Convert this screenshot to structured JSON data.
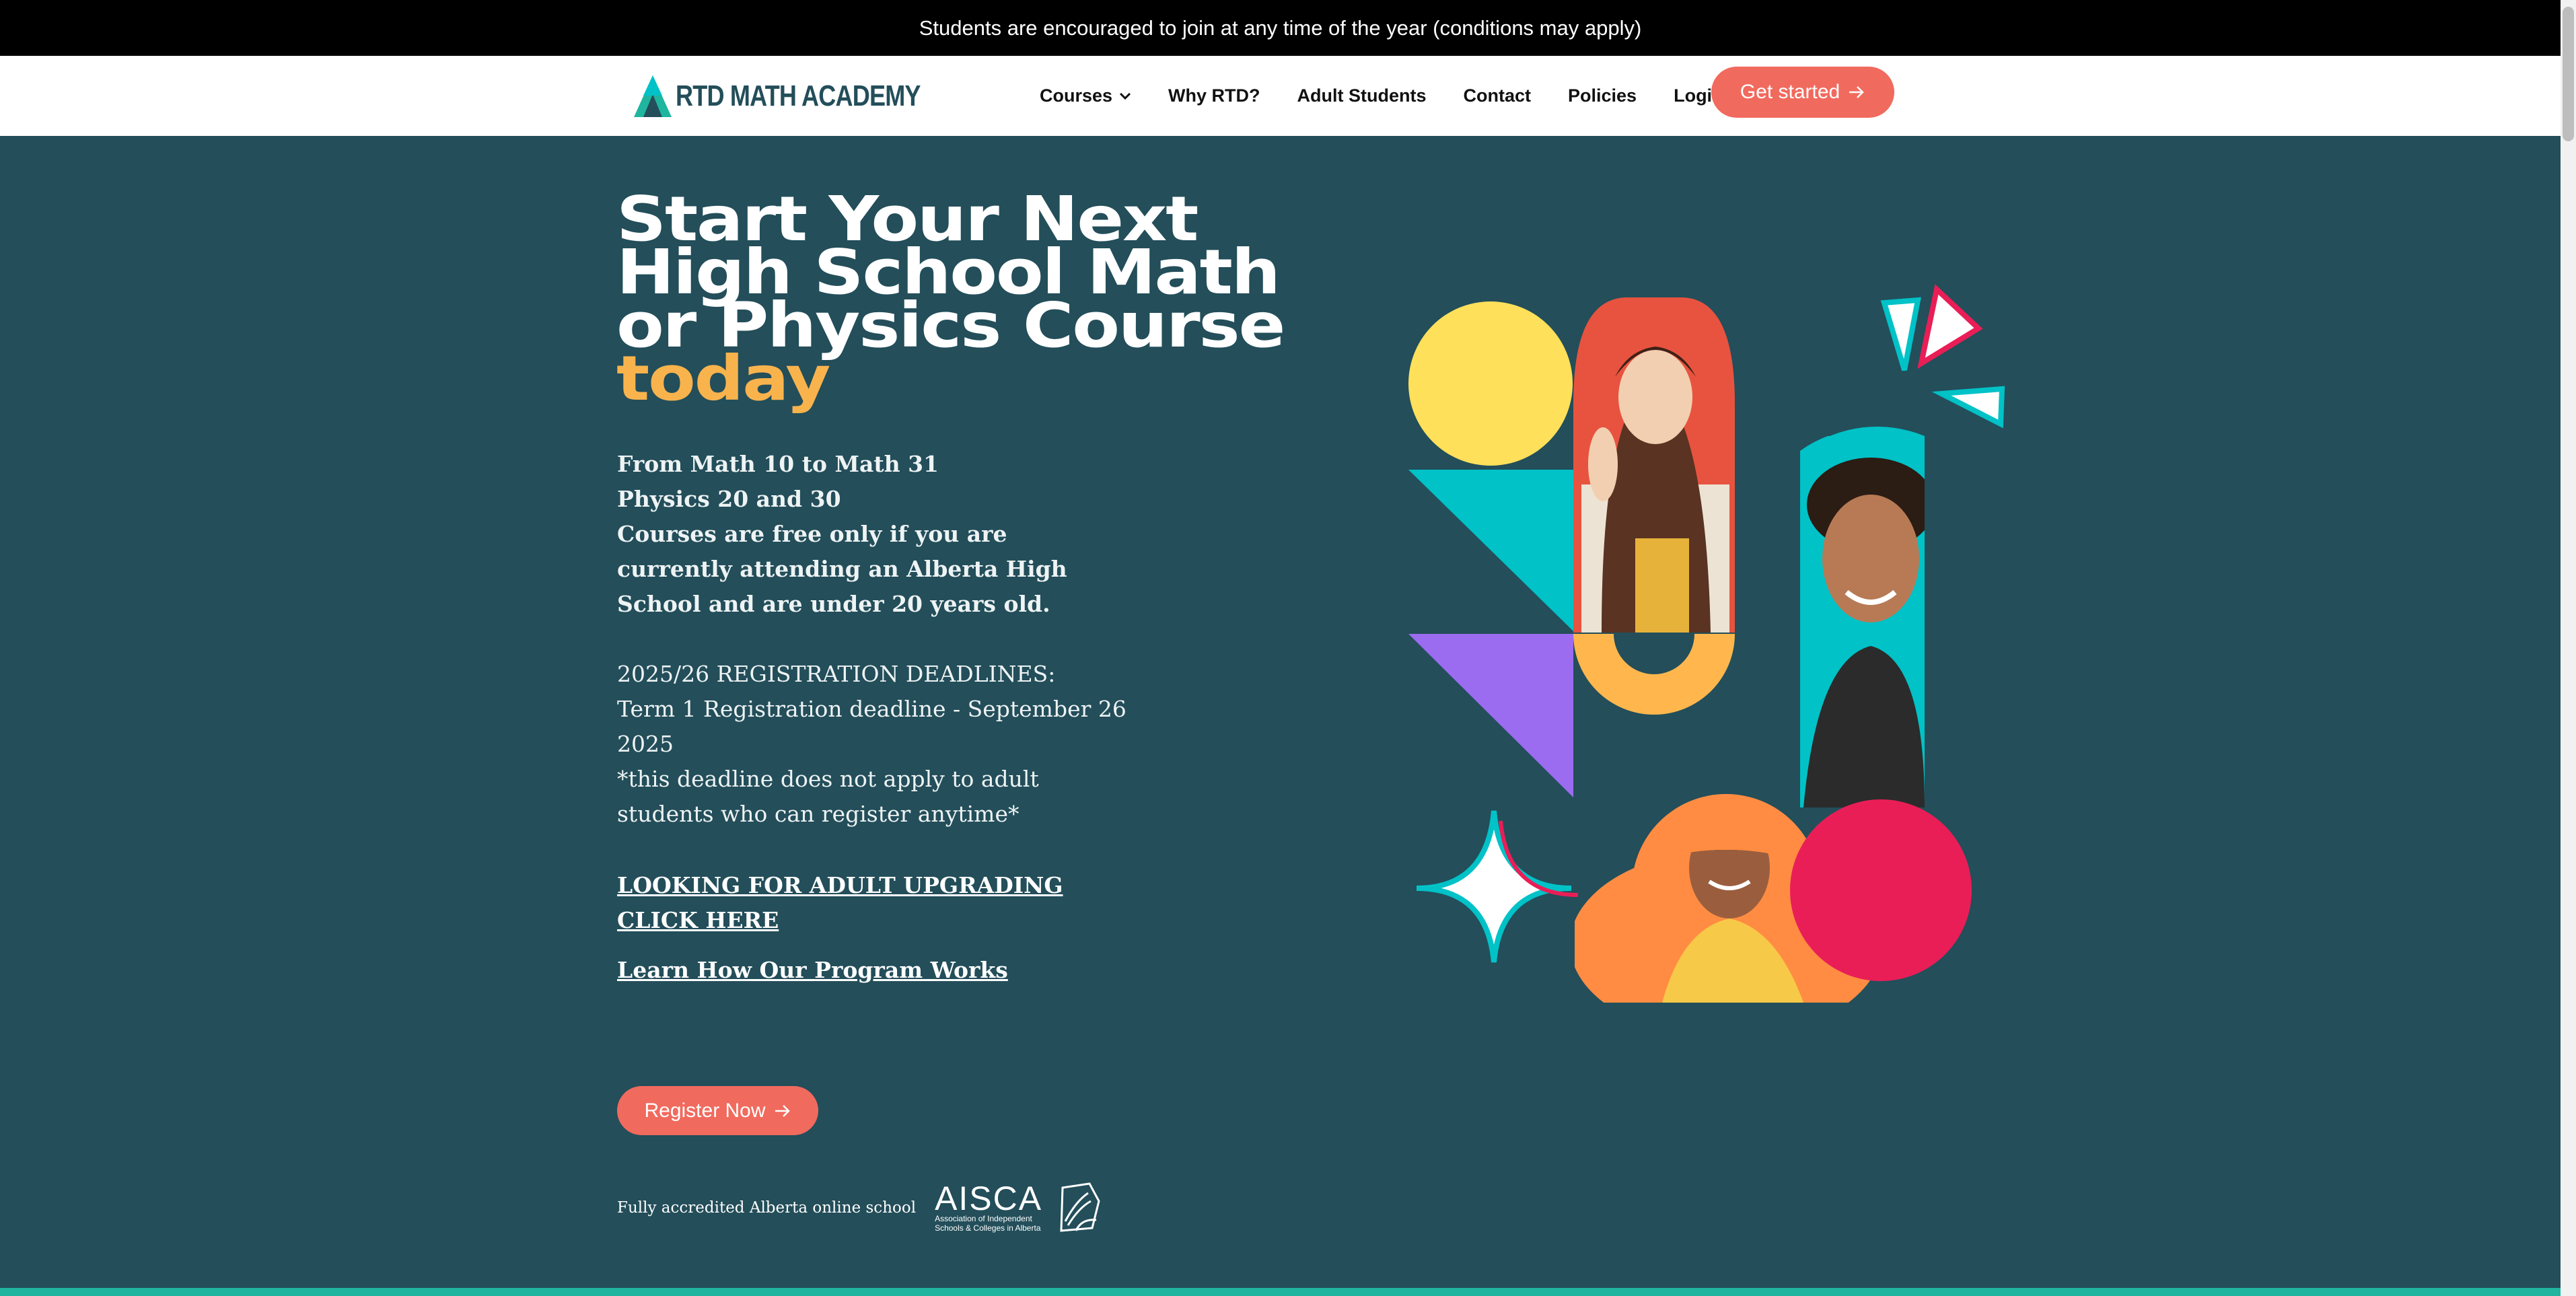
{
  "announcement": "Students are encouraged to join at any time of the year (conditions may apply)",
  "logo": {
    "text": "RTD MATH ACADEMY"
  },
  "nav": {
    "items": [
      "Courses",
      "Why RTD?",
      "Adult Students",
      "Contact",
      "Policies",
      "Login"
    ],
    "get_started": "Get started"
  },
  "hero": {
    "title_lines": [
      "Start Your Next",
      "High School Math",
      "or Physics Course"
    ],
    "title_accent": "today",
    "bold_lines": [
      "From Math 10 to Math 31",
      "Physics 20 and 30",
      "Courses are free only if you are currently attending an Alberta High School and are under 20 years old."
    ],
    "deadlines_heading": "2025/26 REGISTRATION DEADLINES:",
    "deadline_term1": "Term 1 Registration deadline - September 26 2025",
    "deadline_note": "*this deadline does not apply to adult students who can register anytime*",
    "link_adult": "LOOKING FOR ADULT UPGRADING CLICK HERE",
    "link_program": "Learn How Our Program Works",
    "register": "Register Now"
  },
  "accreditation": {
    "text": "Fully accredited Alberta online school",
    "logo_word": "AISCA",
    "logo_sub": "Association of Independent Schools & Colleges in Alberta"
  },
  "colors": {
    "background": "#234e5a",
    "accent": "#f16a5e",
    "highlight": "#f9b34d",
    "teal": "#00c2c7",
    "purple": "#9b6cf0",
    "yellow": "#ffe05a",
    "pink": "#e91e57"
  },
  "icons": [
    "triangle-logo-icon",
    "chevron-down-icon",
    "arrow-right-icon",
    "book-icon"
  ]
}
